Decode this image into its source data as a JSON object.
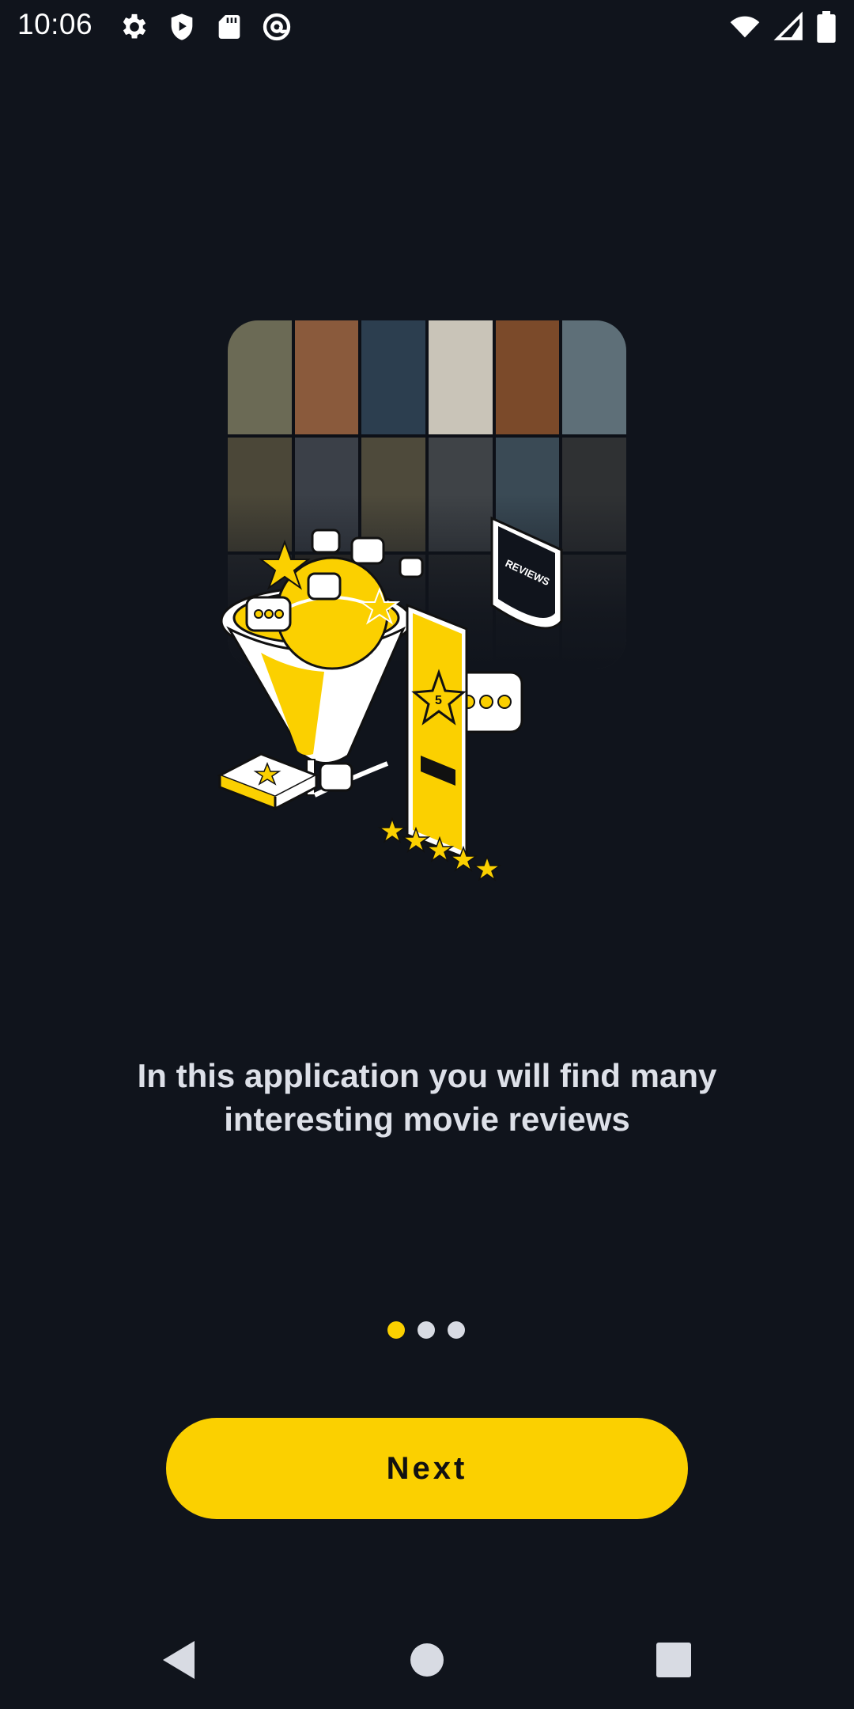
{
  "status_bar": {
    "time": "10:06",
    "left_icons": [
      "settings-icon",
      "shield-play-icon",
      "sd-card-icon",
      "at-sign-icon"
    ],
    "right_icons": [
      "wifi-icon",
      "cellular-signal-icon",
      "battery-icon"
    ]
  },
  "onboarding": {
    "illustration": "movie-reviews-illustration",
    "description": "In this application you will find many interesting movie reviews",
    "page_count": 3,
    "active_page": 1,
    "next_label": "Next"
  },
  "navigation_bar": {
    "buttons": [
      "back-icon",
      "home-icon",
      "recents-icon"
    ]
  },
  "colors": {
    "background": "#10141c",
    "accent": "#fbd000",
    "text": "#dde0e8"
  }
}
